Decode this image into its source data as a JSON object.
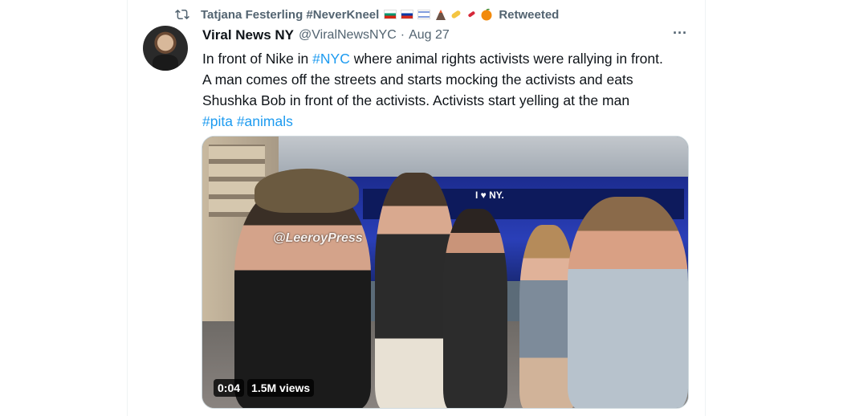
{
  "retweet": {
    "name": "Tatjana Festerling #NeverKneel",
    "label": "Retweeted",
    "emoji_icons": [
      "bulgaria-flag",
      "russia-flag",
      "israel-flag",
      "volcano",
      "pill",
      "syringe",
      "orange"
    ]
  },
  "tweet": {
    "author_name": "Viral News NY",
    "handle": "@ViralNewsNYC",
    "separator": "·",
    "date": "Aug 27",
    "more_label": "···",
    "text_line1_prefix": "In front of Nike in ",
    "text_line1_hashtag": "#NYC",
    "text_line1_suffix": " where animal rights activists were rallying in front.",
    "text_line2": "A man comes off the streets and starts mocking the activists and eats",
    "text_line3": "Shushka Bob in front of the activists. Activists start yelling at the man",
    "hashtag_pita": "#pita",
    "hashtag_animals": "#animals"
  },
  "media": {
    "watermark": "@LeeroyPress",
    "bus_logo": "I ♥ NY.",
    "duration": "0:04",
    "views": "1.5M views"
  },
  "colors": {
    "link": "#1d9bf0",
    "secondary_text": "#536471",
    "primary_text": "#0f1419"
  }
}
